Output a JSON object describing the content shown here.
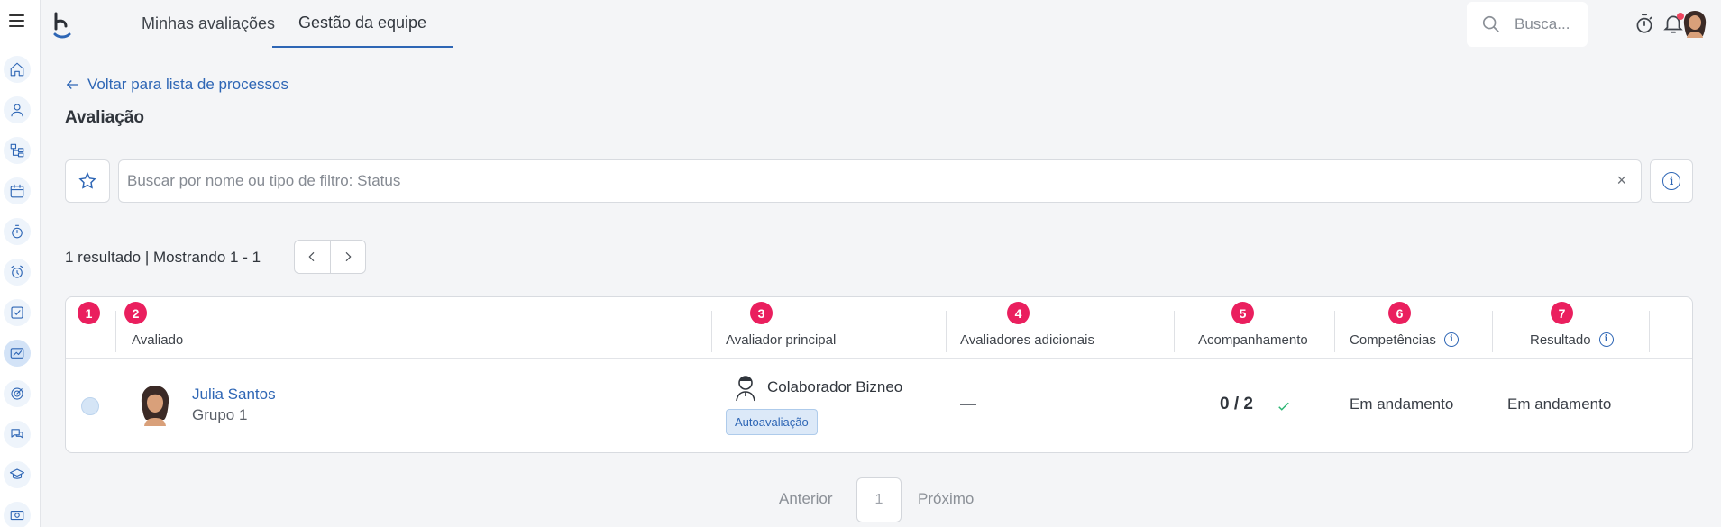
{
  "nav": {
    "tabs": [
      {
        "label": "Minhas avaliações",
        "active": false
      },
      {
        "label": "Gestão da equipe",
        "active": true
      }
    ],
    "search_placeholder": "Busca...",
    "accent": "#2e66b5",
    "rail_icons": [
      "home-icon",
      "user-icon",
      "org-chart-icon",
      "calendar-icon",
      "stopwatch-icon",
      "alarm-icon",
      "checklist-icon",
      "evaluation-icon",
      "target-icon",
      "chat-icon",
      "graduation-icon",
      "money-icon"
    ]
  },
  "page": {
    "back_link": "Voltar para lista de processos",
    "title": "Avaliação",
    "filter_placeholder": "Buscar por nome ou tipo de filtro: Status",
    "clear_symbol": "×",
    "results_text": "1 resultado | Mostrando 1 - 1"
  },
  "table": {
    "columns": [
      {
        "badge": "1",
        "label": ""
      },
      {
        "badge": "2",
        "label": "Avaliado"
      },
      {
        "badge": "3",
        "label": "Avaliador principal"
      },
      {
        "badge": "4",
        "label": "Avaliadores adicionais"
      },
      {
        "badge": "5",
        "label": "Acompanhamento"
      },
      {
        "badge": "6",
        "label": "Competências"
      },
      {
        "badge": "7",
        "label": "Resultado"
      }
    ],
    "rows": [
      {
        "name": "Julia Santos",
        "group": "Grupo 1",
        "evaluator": "Colaborador Bizneo",
        "evaluator_tag": "Autoavaliação",
        "additional": "—",
        "progress": "0 / 2",
        "competencies": "Em andamento",
        "result": "Em andamento"
      }
    ]
  },
  "pagination": {
    "prev": "Anterior",
    "page": "1",
    "next": "Próximo"
  },
  "colors": {
    "badge": "#ea1f5e",
    "check": "#2bb673",
    "notification": "#ef4560"
  }
}
